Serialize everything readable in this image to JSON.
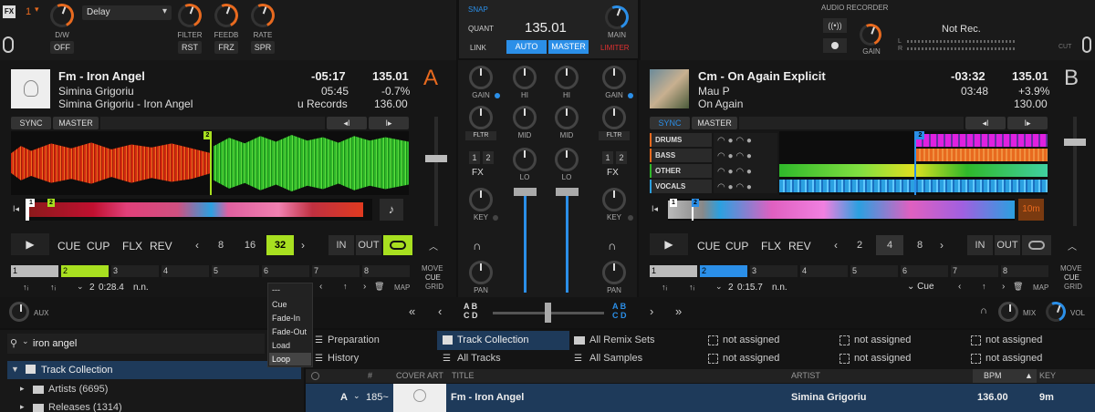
{
  "fx": {
    "badge": "FX",
    "unit_num": "1",
    "effect": "Delay",
    "knobs": [
      "D/W",
      "FILTER",
      "FEEDB",
      "RATE"
    ],
    "buttons": [
      "OFF",
      "RST",
      "FRZ",
      "SPR"
    ]
  },
  "master_panel": {
    "snap": "SNAP",
    "quant": "QUANT",
    "bpm": "135.01",
    "main": "MAIN",
    "link": "LINK",
    "auto": "AUTO",
    "master": "MASTER",
    "limiter": "LIMITER"
  },
  "recorder": {
    "audio": "AUDIO",
    "recorder": "RECORDER",
    "status": "Not Rec.",
    "gain": "GAIN",
    "l": "L",
    "r": "R",
    "cut": "CUT"
  },
  "deck_a": {
    "letter": "A",
    "title": "Fm - Iron Angel",
    "artist": "Simina Grigoriu",
    "album": "Simina Grigoriu - Iron Angel",
    "remaining": "-05:17",
    "elapsed": "05:45",
    "label": "u Records",
    "bpm": "135.01",
    "pitch": "-0.7%",
    "orig_bpm": "136.00",
    "sync": "SYNC",
    "master": "MASTER",
    "beatjump": "2",
    "transport": {
      "cue": "CUE",
      "cup": "CUP",
      "flx": "FLX",
      "rev": "REV"
    },
    "loop_sizes": [
      "8",
      "16",
      "32"
    ],
    "loop_in": "IN",
    "loop_out": "OUT",
    "hotcues": [
      "1",
      "2",
      "3",
      "4",
      "5",
      "6",
      "7",
      "8"
    ],
    "move_labels": [
      "MOVE",
      "CUE",
      "GRID"
    ],
    "move_value": "2",
    "move_pos": "0:28.4",
    "move_type": "n.n.",
    "map": "MAP",
    "marker_1": "1",
    "marker_2": "2"
  },
  "deck_b": {
    "letter": "B",
    "title": "Cm - On Again Explicit",
    "artist": "Mau P",
    "album": "On Again",
    "remaining": "-03:32",
    "elapsed": "03:48",
    "bpm": "135.01",
    "pitch": "+3.9%",
    "orig_bpm": "130.00",
    "sync": "SYNC",
    "master": "MASTER",
    "stems": [
      "DRUMS",
      "BASS",
      "OTHER",
      "VOCALS"
    ],
    "time_badge": "10m",
    "transport": {
      "cue": "CUE",
      "cup": "CUP",
      "flx": "FLX",
      "rev": "REV"
    },
    "loop_sizes": [
      "2",
      "4",
      "8"
    ],
    "loop_in": "IN",
    "loop_out": "OUT",
    "hotcues": [
      "1",
      "2",
      "3",
      "4",
      "5",
      "6",
      "7",
      "8"
    ],
    "move_labels": [
      "MOVE",
      "CUE",
      "GRID"
    ],
    "move_value": "2",
    "move_pos": "0:15.7",
    "move_type": "n.n.",
    "cue_mode": "Cue",
    "map": "MAP",
    "marker_1": "1",
    "marker_2": "2"
  },
  "mixer": {
    "gain": "GAIN",
    "hi": "HI",
    "mid": "MID",
    "lo": "LO",
    "fltr": "FLTR",
    "fx": "FX",
    "key": "KEY",
    "pan": "PAN",
    "fx_assign": [
      "1",
      "2"
    ]
  },
  "crossfader": {
    "aux": "AUX",
    "ab": "A B",
    "cd": "C D",
    "mix": "MIX",
    "vol": "VOL"
  },
  "context_menu": {
    "header": "---",
    "items": [
      "Cue",
      "Fade-In",
      "Fade-Out",
      "Load",
      "Loop"
    ]
  },
  "browser": {
    "search_value": "iron angel",
    "tree": [
      {
        "label": "Track Collection"
      },
      {
        "label": "Artists (6695)"
      },
      {
        "label": "Releases (1314)"
      }
    ],
    "favorites": [
      "Preparation",
      "Track Collection",
      "All Remix Sets",
      "not assigned",
      "not assigned",
      "not assigned",
      "History",
      "All Tracks",
      "All Samples",
      "not assigned",
      "not assigned",
      "not assigned"
    ],
    "columns": {
      "num": "#",
      "cover": "COVER ART",
      "title": "TITLE",
      "artist": "ARTIST",
      "bpm": "BPM",
      "key": "KEY"
    },
    "rows": [
      {
        "deck": "A",
        "num": "185~",
        "title": "Fm - Iron Angel",
        "artist": "Simina Grigoriu",
        "bpm": "136.00",
        "key": "9m"
      }
    ]
  },
  "colors": {
    "accent_orange": "#e86a1f",
    "accent_blue": "#2b8fe8",
    "lime": "#a8e020",
    "deck_a_wave_left": "#d42a10",
    "deck_a_wave_right": "#2fb82a"
  }
}
